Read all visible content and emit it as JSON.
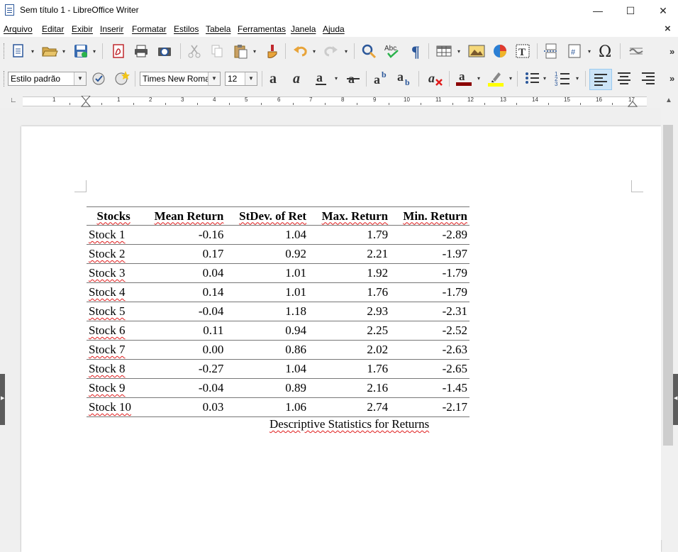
{
  "window": {
    "title": "Sem título 1 - LibreOffice Writer",
    "minimize": "—",
    "maximize": "☐",
    "close": "✕"
  },
  "menu": {
    "items": [
      "Arquivo",
      "Editar",
      "Exibir",
      "Inserir",
      "Formatar",
      "Estilos",
      "Tabela",
      "Ferramentas",
      "Janela",
      "Ajuda"
    ],
    "close_doc": "×"
  },
  "formatting": {
    "paragraph_style": "Estilo padrão",
    "font_name": "Times New Roman",
    "font_size": "12"
  },
  "ruler": {
    "numbers": [
      "1",
      "1",
      "2",
      "3",
      "4",
      "5",
      "6",
      "7",
      "8",
      "9",
      "10",
      "11",
      "12",
      "13",
      "14",
      "15",
      "16",
      "17"
    ]
  },
  "document": {
    "table": {
      "headers": [
        "Stocks",
        "Mean Return",
        "StDev. of Ret",
        "Max. Return",
        "Min. Return"
      ],
      "rows": [
        [
          "Stock 1",
          "-0.16",
          "1.04",
          "1.79",
          "-2.89"
        ],
        [
          "Stock 2",
          "0.17",
          "0.92",
          "2.21",
          "-1.97"
        ],
        [
          "Stock 3",
          "0.04",
          "1.01",
          "1.92",
          "-1.79"
        ],
        [
          "Stock 4",
          "0.14",
          "1.01",
          "1.76",
          "-1.79"
        ],
        [
          "Stock 5",
          "-0.04",
          "1.18",
          "2.93",
          "-2.31"
        ],
        [
          "Stock 6",
          "0.11",
          "0.94",
          "2.25",
          "-2.52"
        ],
        [
          "Stock 7",
          "0.00",
          "0.86",
          "2.02",
          "-2.63"
        ],
        [
          "Stock 8",
          "-0.27",
          "1.04",
          "1.76",
          "-2.65"
        ],
        [
          "Stock 9",
          "-0.04",
          "0.89",
          "2.16",
          "-1.45"
        ],
        [
          "Stock 10",
          "0.03",
          "1.06",
          "2.74",
          "-2.17"
        ]
      ]
    },
    "caption": "Descriptive Statistics for Returns"
  },
  "colors": {
    "font_color": "#8b0000",
    "highlight_color": "#ffff00",
    "accent_blue": "#2b579a",
    "spell_error": "#e01b1b"
  }
}
